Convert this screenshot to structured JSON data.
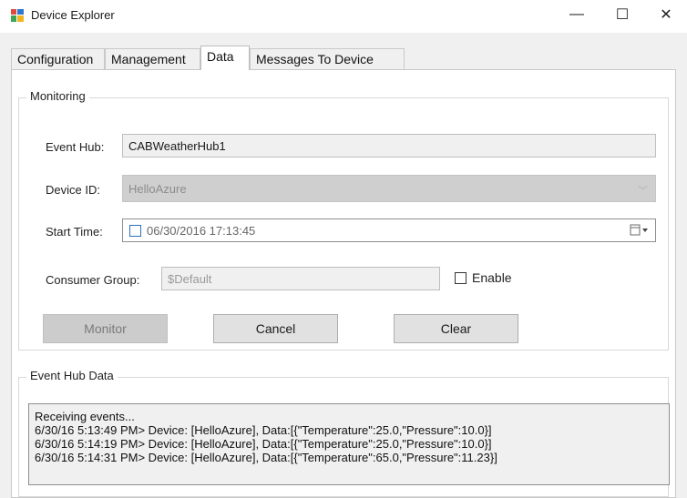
{
  "window": {
    "title": "Device Explorer",
    "minimize_glyph": "—",
    "maximize_glyph": "☐",
    "close_glyph": "✕"
  },
  "tabs": [
    {
      "label": "Configuration",
      "active": false
    },
    {
      "label": "Management",
      "active": false
    },
    {
      "label": "Data",
      "active": true
    },
    {
      "label": "Messages To Device",
      "active": false
    }
  ],
  "monitoring": {
    "legend": "Monitoring",
    "event_hub_label": "Event Hub:",
    "event_hub_value": "CABWeatherHub1",
    "device_id_label": "Device ID:",
    "device_id_value": "HelloAzure",
    "start_time_label": "Start Time:",
    "start_time_value": "06/30/2016 17:13:45",
    "consumer_group_label": "Consumer Group:",
    "consumer_group_value": "$Default",
    "enable_label": "Enable",
    "monitor_button": "Monitor",
    "cancel_button": "Cancel",
    "clear_button": "Clear"
  },
  "event_hub_data": {
    "legend": "Event Hub Data",
    "lines": [
      "Receiving events...",
      "6/30/16 5:13:49 PM> Device: [HelloAzure], Data:[{\"Temperature\":25.0,\"Pressure\":10.0}]",
      "6/30/16 5:14:19 PM> Device: [HelloAzure], Data:[{\"Temperature\":25.0,\"Pressure\":10.0}]",
      "6/30/16 5:14:31 PM> Device: [HelloAzure], Data:[{\"Temperature\":65.0,\"Pressure\":11.23}]"
    ]
  },
  "icons": {
    "app": "device-explorer-icon",
    "calendar": "calendar-dropdown-icon",
    "combo": "chevron-down-icon"
  },
  "colors": {
    "tab_active_bg": "#ffffff",
    "client_bg": "#f0f0f0",
    "disabled_button_bg": "#cccccc",
    "checkbox_blue": "#2f6fb8"
  }
}
